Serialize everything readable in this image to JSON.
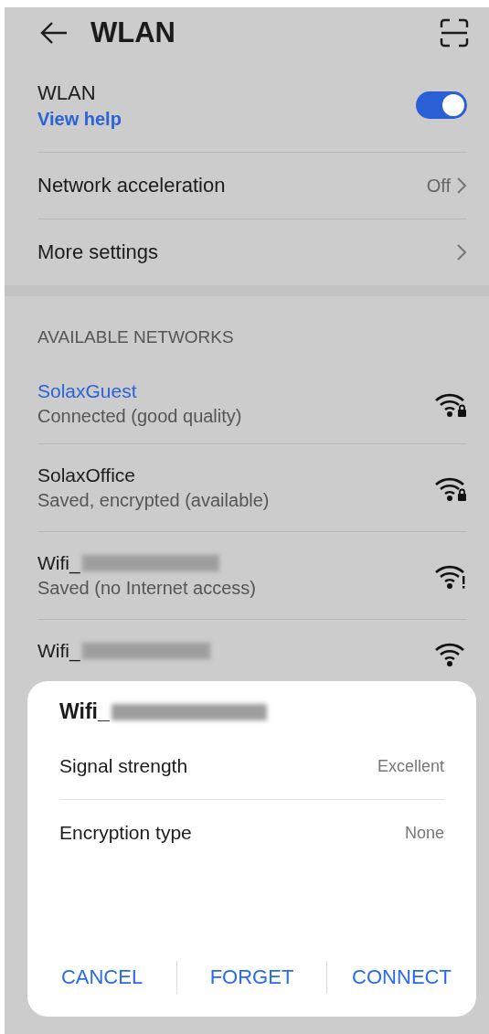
{
  "header": {
    "title": "WLAN"
  },
  "wlan": {
    "label": "WLAN",
    "help": "View help",
    "on": true
  },
  "settings": [
    {
      "label": "Network acceleration",
      "value": "Off"
    },
    {
      "label": "More settings"
    }
  ],
  "available": {
    "heading": "AVAILABLE NETWORKS",
    "networks": [
      {
        "name": "SolaxGuest",
        "status": "Connected (good quality)",
        "connected": true,
        "blurred": false,
        "kind": "lock"
      },
      {
        "name": "SolaxOffice",
        "status": "Saved, encrypted (available)",
        "connected": false,
        "blurred": false,
        "kind": "lock"
      },
      {
        "name": "Wifi_",
        "status": "Saved (no Internet access)",
        "connected": false,
        "blurred": true,
        "kind": "alert"
      },
      {
        "name": "Wifi_",
        "connected": false,
        "blurred": true,
        "kind": "plain"
      }
    ]
  },
  "dialog": {
    "title": "Wifi_",
    "title_blurred": true,
    "rows": [
      {
        "label": "Signal strength",
        "value": "Excellent"
      },
      {
        "label": "Encryption type",
        "value": "None"
      }
    ],
    "buttons": [
      "CANCEL",
      "FORGET",
      "CONNECT"
    ]
  }
}
